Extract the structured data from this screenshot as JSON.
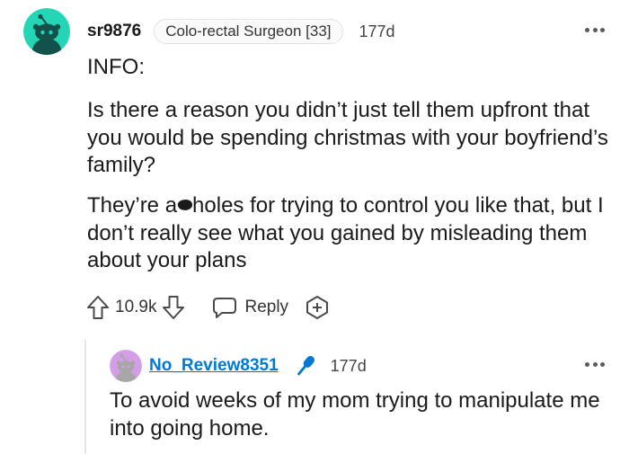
{
  "comment": {
    "username": "sr9876",
    "flair": "Colo-rectal Surgeon [33]",
    "age": "177d",
    "info_label": "INFO:",
    "paragraph1": "Is there a reason you didn’t just tell them upfront that you would be spending christmas with your boyfriend’s family?",
    "paragraph2_before": "They’re a",
    "paragraph2_after": "holes for trying to control you like that, but I don’t really see what you gained by misleading them about your plans",
    "votes": "10.9k",
    "reply_label": "Reply",
    "avatar_color": "#24d6b5"
  },
  "reply": {
    "username": "No_Review8351",
    "age": "177d",
    "text": "To avoid weeks of my mom trying to manipulate me into going home.",
    "avatar_color": "#d49ee6",
    "user_color": "#0079d3"
  },
  "icons": [
    "snoo-avatar-icon",
    "more-options-icon",
    "upvote-arrow-icon",
    "downvote-arrow-icon",
    "reply-bubble-icon",
    "award-plus-icon",
    "microphone-icon"
  ]
}
